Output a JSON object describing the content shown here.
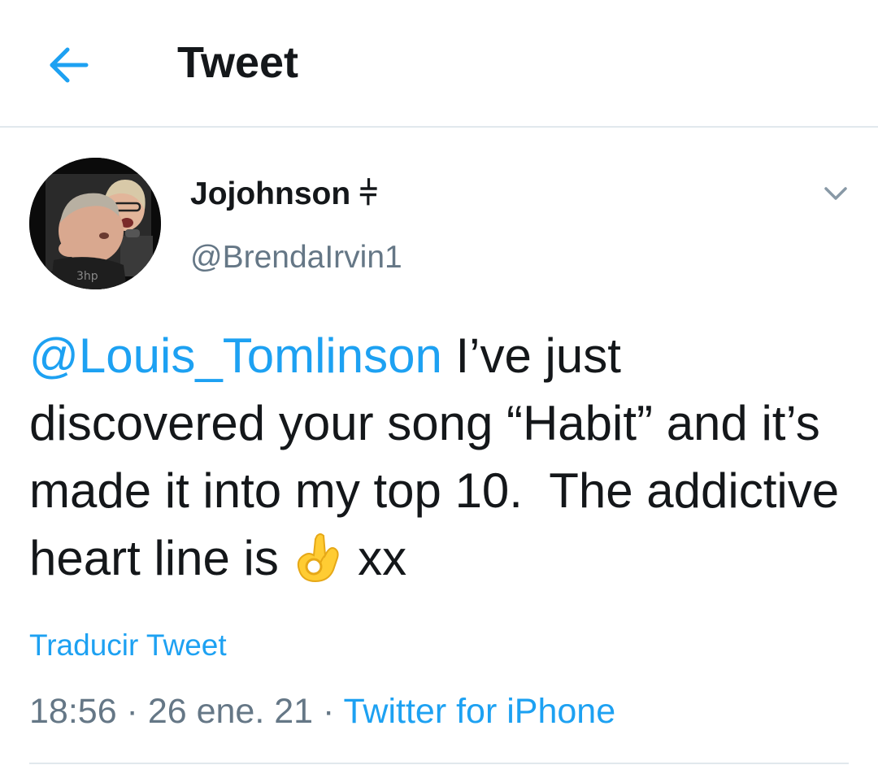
{
  "header": {
    "title": "Tweet",
    "back_icon": "arrow-left-icon"
  },
  "tweet": {
    "display_name": "Jojohnson",
    "name_symbol": "⫩",
    "handle": "@BrendaIrvin1",
    "more_icon": "chevron-down-icon",
    "mention": "@Louis_Tomlinson",
    "text_part_1": " I’ve just discovered your song “Habit” and it’s made it into my top 10.  The addictive heart line is ",
    "emoji": "ok-hand-emoji",
    "text_part_2": " xx",
    "translate_label": "Traducir Tweet",
    "time": "18:56",
    "separator": " · ",
    "date": "26 ene. 21",
    "source": "Twitter for iPhone"
  },
  "colors": {
    "accent": "#1da1f2",
    "text_primary": "#14171a",
    "text_secondary": "#657786",
    "divider": "#e1e8ed"
  }
}
